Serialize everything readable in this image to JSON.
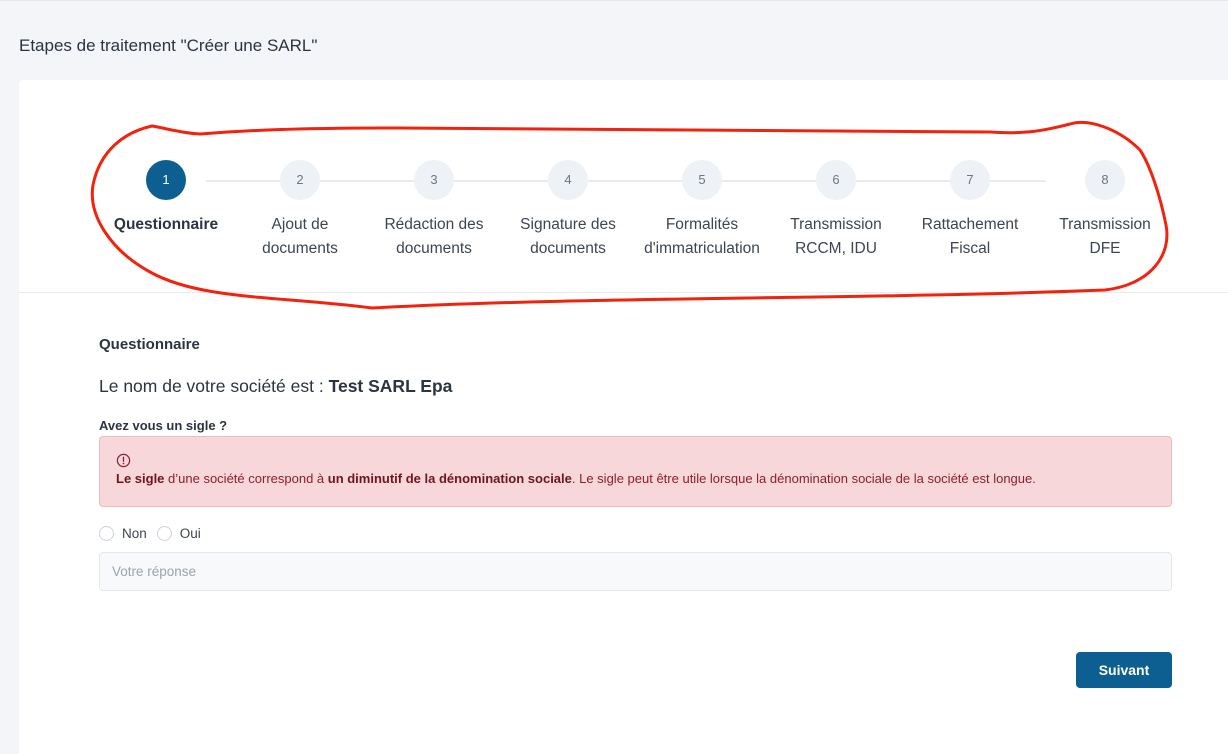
{
  "page": {
    "heading": "Etapes de traitement \"Créer une SARL\""
  },
  "stepper": {
    "steps": [
      {
        "number": "1",
        "line1": "Questionnaire",
        "line2": ""
      },
      {
        "number": "2",
        "line1": "Ajout de",
        "line2": "documents"
      },
      {
        "number": "3",
        "line1": "Rédaction des",
        "line2": "documents"
      },
      {
        "number": "4",
        "line1": "Signature des",
        "line2": "documents"
      },
      {
        "number": "5",
        "line1": "Formalités",
        "line2": "d'immatriculation"
      },
      {
        "number": "6",
        "line1": "Transmission",
        "line2": "RCCM, IDU"
      },
      {
        "number": "7",
        "line1": "Rattachement",
        "line2": "Fiscal"
      },
      {
        "number": "8",
        "line1": "Transmission",
        "line2": "DFE"
      }
    ],
    "active_step": 1
  },
  "questionnaire": {
    "title": "Questionnaire",
    "company_prefix": "Le nom de votre société est : ",
    "company_name": "Test SARL Epa",
    "question": "Avez vous un sigle ?",
    "alert": {
      "strong1": "Le sigle",
      "text1": " d’une société correspond à ",
      "strong2": "un diminutif de la dénomination sociale",
      "text2": ". Le sigle peut être utile lorsque la dénomination sociale de la société est longue."
    },
    "options": [
      "Non",
      "Oui"
    ],
    "answer_placeholder": "Votre réponse",
    "answer_value": ""
  },
  "actions": {
    "next_label": "Suivant"
  },
  "colors": {
    "primary": "#0d5f92",
    "alert_bg": "#f8d7da",
    "alert_text": "#8a1f2b",
    "annotation": "#f2230e"
  }
}
